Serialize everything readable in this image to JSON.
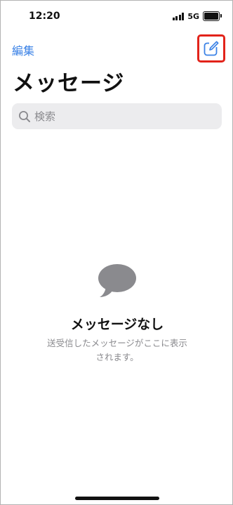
{
  "status_bar": {
    "time": "12:20",
    "network": "5G"
  },
  "nav": {
    "edit_label": "編集",
    "compose_icon": "compose-icon"
  },
  "title": "メッセージ",
  "search": {
    "placeholder": "検索",
    "icon": "search-icon"
  },
  "empty_state": {
    "icon": "message-bubble-icon",
    "title": "メッセージなし",
    "description": "送受信したメッセージがここに表示されます。"
  },
  "colors": {
    "accent": "#3b82e6",
    "highlight": "#e2231a",
    "secondary_text": "#8a8a8e",
    "search_background": "#ececee"
  }
}
